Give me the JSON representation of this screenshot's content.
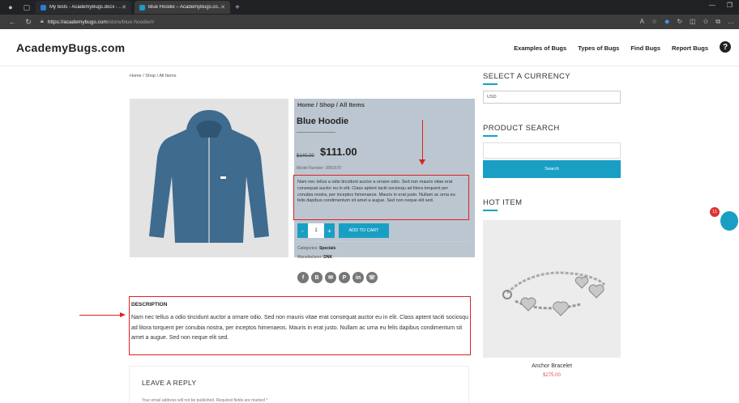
{
  "browser": {
    "tabs": [
      {
        "title": "My tests - AcademyBugs.docx - ..."
      },
      {
        "title": "Blue Hoodie – AcademyBugs.co..."
      }
    ],
    "url_host": "https://academybugs.com",
    "url_path": "/store/blue-hoodie/#"
  },
  "site": {
    "logo": "AcademyBugs.com",
    "nav": [
      "Examples of Bugs",
      "Types of Bugs",
      "Find Bugs",
      "Report Bugs"
    ]
  },
  "breadcrumb": "Home / Shop / All Items",
  "product": {
    "breadcrumb": "Home / Shop / All Items",
    "title": "Blue Hoodie",
    "old_price": "$140.00",
    "new_price": "$111.00",
    "model": "Model Number: 3581570",
    "short_description": "Nam nec tellus a odio tincidunt auctor a ornare odio. Sed non mauris vitae erat consequat auctor eu in elit. Class aptent taciti sociosqu ad litora torquent per conubia nostra, per inceptos himenaeos. Mauris in erat justo. Nullam ac urna eu felis dapibus condimentum sit amet a augue. Sed non neque elit sed.",
    "qty_minus": "-",
    "qty_value": "1",
    "qty_plus": "+",
    "add_to_cart": "ADD TO CART",
    "categories_label": "Categories:",
    "categories_value": "Specials",
    "manufacturer_label": "Manufacturer:",
    "manufacturer_value": "DNK",
    "share_icons": [
      "facebook-icon",
      "blogger-icon",
      "email-icon",
      "pinterest-icon",
      "linkedin-icon",
      "whatsapp-icon"
    ]
  },
  "description": {
    "heading": "DESCRIPTION",
    "text": "Nam nec tellus a odio tincidunt auctor a ornare odio. Sed non mauris vitae erat consequat auctor eu in elit. Class aptent taciti sociosqu ad litora torquent per conubia nostra, per inceptos himenaeos. Mauris in erat justo. Nullam ac urna eu felis dapibus condimentum sit amet a augue. Sed non neque elit sed."
  },
  "reply": {
    "title": "LEAVE A REPLY",
    "note": "Your email address will not be published. Required fields are marked *"
  },
  "sidebar": {
    "currency_heading": "SELECT A CURRENCY",
    "currency_value": "USD",
    "search_heading": "PRODUCT SEARCH",
    "search_button": "Search",
    "hot_heading": "HOT ITEM",
    "hot_name": "Anchor Bracelet",
    "hot_price": "$275.00"
  },
  "bug_widget": {
    "count": "11"
  },
  "colors": {
    "accent": "#1a9fc4",
    "annotation": "#dd2222",
    "sale_price": "#d9534f"
  }
}
